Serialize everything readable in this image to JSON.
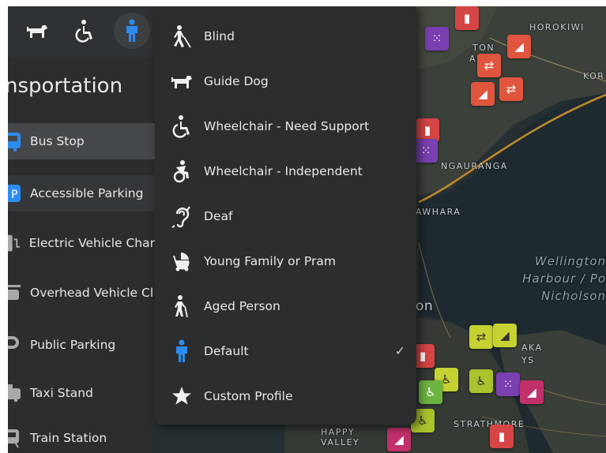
{
  "toolbar": {
    "icons": [
      "guide-dog-icon",
      "wheelchair-icon",
      "person-icon"
    ],
    "active_icon": "person-icon",
    "accent": "#2d8cf0"
  },
  "panel": {
    "title": "nsportation",
    "items": [
      {
        "label": "Bus Stop",
        "icon": "bus-icon",
        "selected": true
      },
      {
        "label": "Accessible Parking",
        "icon": "accessible-parking-icon"
      },
      {
        "label": "Electric Vehicle Char",
        "icon": "ev-charger-icon"
      },
      {
        "label": "Overhead Vehicle Cl",
        "icon": "overhead-clearance-icon"
      },
      {
        "label": "Public Parking",
        "icon": "parking-icon"
      },
      {
        "label": "Taxi Stand",
        "icon": "taxi-icon"
      },
      {
        "label": "Train Station",
        "icon": "train-icon"
      }
    ]
  },
  "profile_menu": {
    "items": [
      {
        "label": "Blind",
        "icon": "blind-icon"
      },
      {
        "label": "Guide Dog",
        "icon": "guide-dog-icon"
      },
      {
        "label": "Wheelchair - Need Support",
        "icon": "wheelchair-icon"
      },
      {
        "label": "Wheelchair - Independent",
        "icon": "wheelchair-active-icon"
      },
      {
        "label": "Deaf",
        "icon": "deaf-icon"
      },
      {
        "label": "Young Family or Pram",
        "icon": "pram-icon"
      },
      {
        "label": "Aged Person",
        "icon": "aged-person-icon"
      },
      {
        "label": "Default",
        "icon": "person-icon",
        "checked": true,
        "check": "✓"
      },
      {
        "label": "Custom Profile",
        "icon": "star-icon"
      }
    ]
  },
  "map": {
    "labels": {
      "horokiwi": "HOROKIWI",
      "kor": "KOR",
      "ngauranga": "NGAURANGA",
      "awhara": "AWHARA",
      "harbour": "Wellington\nHarbour / Po\nNicholson",
      "on": "on",
      "aka": "AKA",
      "ys": "YS",
      "strathmore": "STRATHMORE",
      "ton": "TON",
      "ark": "ARK",
      "happy_valley": "HAPPY\nVALLEY"
    },
    "pin_colors": {
      "bus": "#d64545",
      "dots": "#7a3fb0",
      "arrows": "#e0553d",
      "ramp": "#c5d231",
      "wheelchair": "#a8c32d",
      "green": "#6db33f",
      "magenta": "#c0306a"
    }
  }
}
